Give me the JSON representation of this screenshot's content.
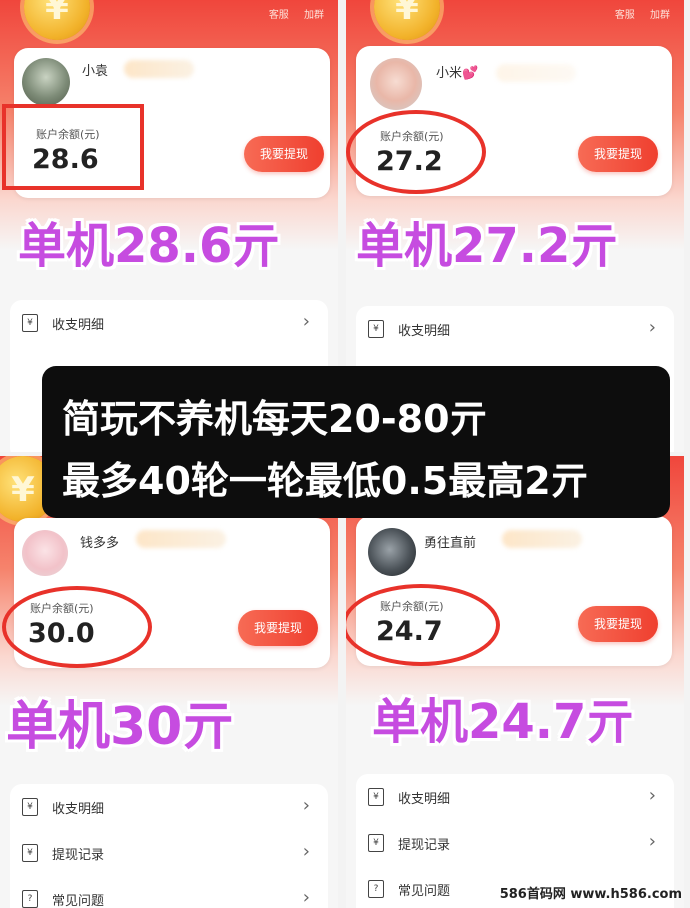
{
  "top_links": [
    "客服",
    "加群"
  ],
  "balance_label": "账户余额(元)",
  "withdraw_label": "我要提现",
  "panels": [
    {
      "user": "小袁",
      "balance": "28.6",
      "overlay": "单机28.6亓",
      "menu": [
        "收支明细"
      ]
    },
    {
      "user": "小米💕",
      "balance": "27.2",
      "overlay": "单机27.2亓",
      "menu": [
        "收支明细"
      ]
    },
    {
      "user": "钱多多",
      "balance": "30.0",
      "overlay": "单机30亓",
      "menu": [
        "收支明细",
        "提现记录",
        "常见问题"
      ]
    },
    {
      "user": "勇往直前",
      "balance": "24.7",
      "overlay": "单机24.7亓",
      "menu": [
        "收支明细",
        "提现记录",
        "常见问题"
      ]
    }
  ],
  "banner": {
    "line1": "简玩不养机每天20-80亓",
    "line2": "最多40轮一轮最低0.5最高2亓"
  },
  "icons": {
    "coin": "yuan-coin-icon",
    "menu_chevron": "chevron-right-icon",
    "ledger": "ledger-icon",
    "receipt": "receipt-icon",
    "help": "question-icon"
  },
  "colors": {
    "accent": "#ef3f2f",
    "highlight": "#e8322a",
    "overlay_text": "#c64ce0",
    "banner_bg": "#0d0d0d"
  },
  "watermark": "586首码网 www.h586.com"
}
